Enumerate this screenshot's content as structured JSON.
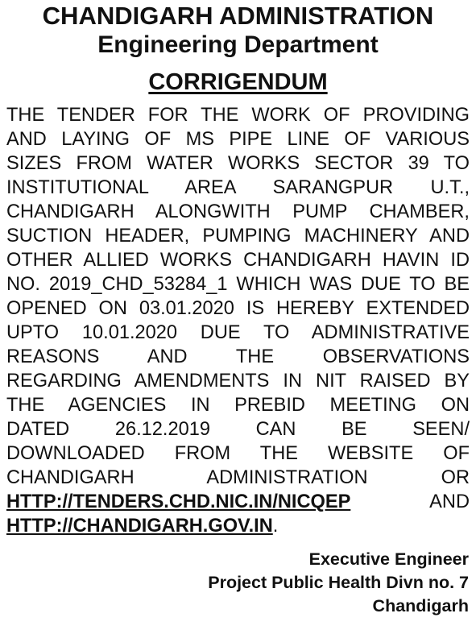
{
  "header": {
    "org": "CHANDIGARH ADMINISTRATION",
    "department": "Engineering Department",
    "notice_type": "CORRIGENDUM"
  },
  "body": {
    "lines": [
      "THE TENDER FOR THE WORK OF PROVIDING",
      "AND LAYING OF MS PIPE LINE OF VARIOUS",
      "SIZES FROM WATER WORKS SECTOR 39 TO",
      "INSTITUTIONAL AREA SARANGPUR U.T.,",
      "CHANDIGARH ALONGWITH PUMP CHAMBER,",
      "SUCTION HEADER, PUMPING MACHINERY AND",
      "OTHER ALLIED WORKS CHANDIGARH HAVIN ID",
      "NO. 2019_CHD_53284_1 WHICH WAS DUE TO BE",
      "OPENED ON 03.01.2020 IS HEREBY EXTENDED",
      "UPTO 10.01.2020 DUE TO ADMINISTRATIVE",
      "REASONS AND THE OBSERVATIONS",
      "REGARDING AMENDMENTS IN NIT RAISED BY",
      "THE AGENCIES IN PREBID MEETING ON",
      "DATED 26.12.2019 CAN BE SEEN/",
      "DOWNLOADED FROM THE WEBSITE OF",
      "CHANDIGARH ADMINISTRATION OR"
    ],
    "link1": "HTTP://TENDERS.CHD.NIC.IN/NICQEP",
    "link_joiner": "AND",
    "link2": "HTTP://CHANDIGARH.GOV.IN",
    "end_punct": "."
  },
  "signature": {
    "designation": "Executive Engineer",
    "division": "Project Public Health Divn no. 7",
    "place": "Chandigarh"
  }
}
